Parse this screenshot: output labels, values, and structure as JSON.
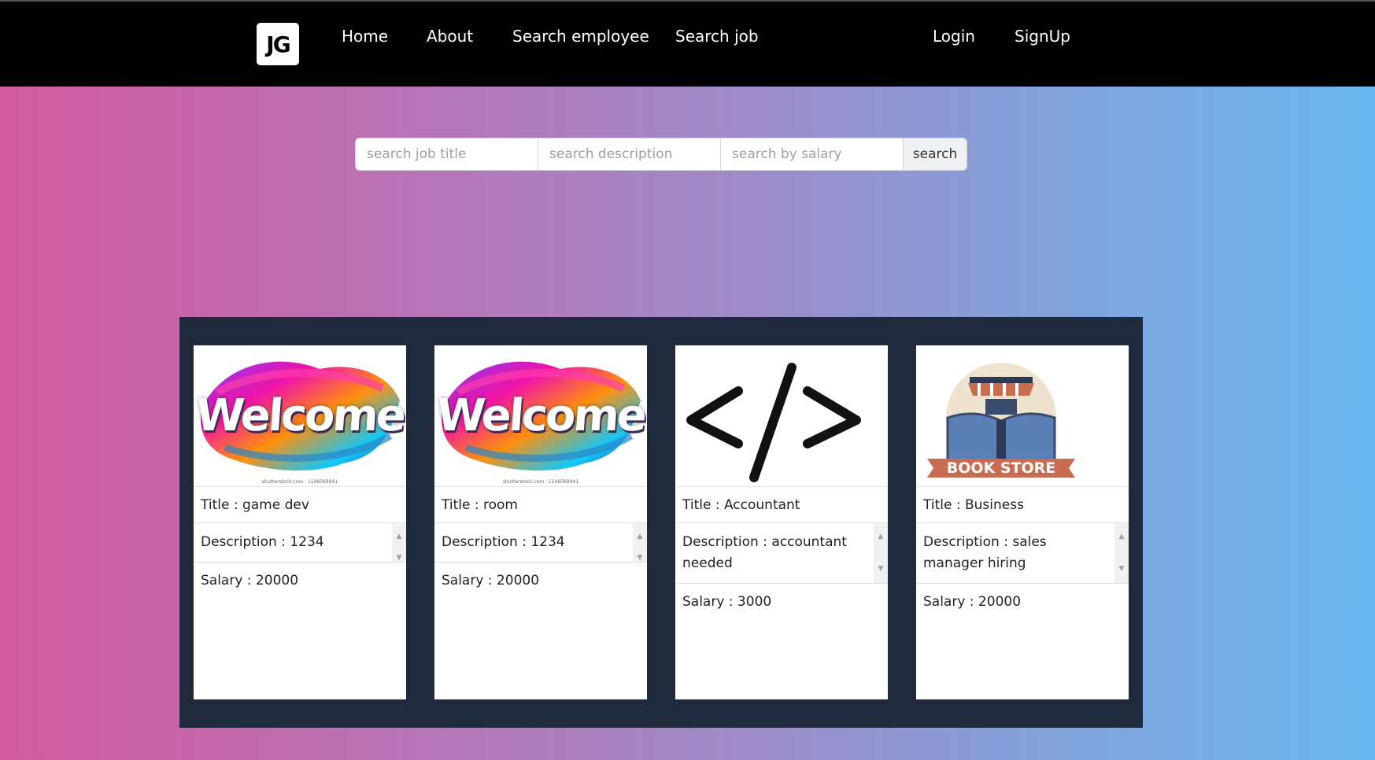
{
  "nav": {
    "logo": "JG",
    "links": [
      "Home",
      "About",
      "Search employee",
      "Search job"
    ],
    "auth": [
      "Login",
      "SignUp"
    ]
  },
  "search": {
    "title_placeholder": "search job title",
    "description_placeholder": "search description",
    "salary_placeholder": "search by salary",
    "button": "search"
  },
  "jobs": [
    {
      "image": "welcome",
      "image_text": "Welcome",
      "watermark": "shutterstock.com · 1146069941",
      "title": "Title : game dev",
      "description": "Description : 1234",
      "salary": "Salary : 20000"
    },
    {
      "image": "welcome",
      "image_text": "Welcome",
      "watermark": "shutterstock.com · 1146069941",
      "title": "Title : room",
      "description": "Description : 1234",
      "salary": "Salary : 20000"
    },
    {
      "image": "code-icon",
      "image_text": "</>",
      "title": "Title : Accountant",
      "description": "Description : accountant needed",
      "salary": "Salary : 3000"
    },
    {
      "image": "book-store",
      "image_text": "BOOK STORE",
      "title": "Title : Business",
      "description": "Description : sales manager hiring",
      "salary": "Salary : 20000"
    }
  ],
  "colors": {
    "navbar": "#000000",
    "panel": "#1f2a3c",
    "gradient_start": "#d35a9e",
    "gradient_end": "#69b7ef"
  }
}
